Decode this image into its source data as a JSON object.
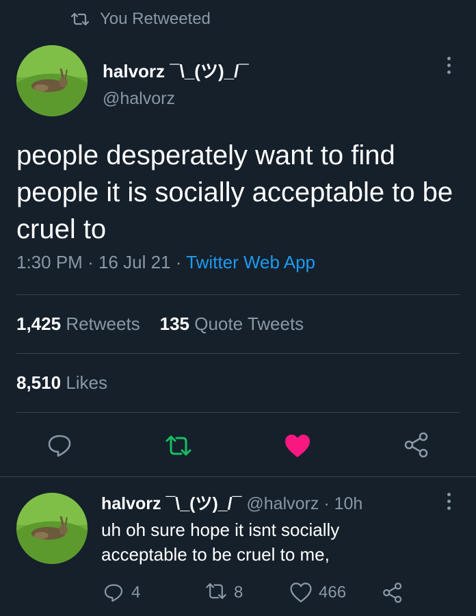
{
  "retweet_banner": {
    "text": "You Retweeted",
    "icon": "retweet-icon"
  },
  "tweet": {
    "display_name": "halvorz ¯\\_(ツ)_/¯",
    "handle": "@halvorz",
    "avatar": "avatar-hare-icon",
    "text": "people desperately want to find people it is socially acceptable to be cruel to",
    "time": "1:30 PM",
    "sep1": "·",
    "date": "16 Jul 21",
    "sep2": "·",
    "source": "Twitter Web App",
    "retweets_count": "1,425",
    "retweets_label": "Retweets",
    "quote_count": "135",
    "quote_label": "Quote Tweets",
    "likes_count": "8,510",
    "likes_label": "Likes",
    "actions": [
      "reply-icon",
      "retweet-icon",
      "like-icon",
      "share-icon"
    ],
    "colors": {
      "retweet_active": "#17bf63",
      "like_active": "#f91880",
      "link": "#1d9bf0"
    }
  },
  "reply": {
    "display_name": "halvorz ¯\\_(ツ)_/¯",
    "handle": "@halvorz",
    "sep": "·",
    "time": "10h",
    "text": "uh oh sure hope it isnt socially acceptable to be cruel to me,",
    "reply_count": "4",
    "retweet_count": "8",
    "like_count": "466"
  }
}
